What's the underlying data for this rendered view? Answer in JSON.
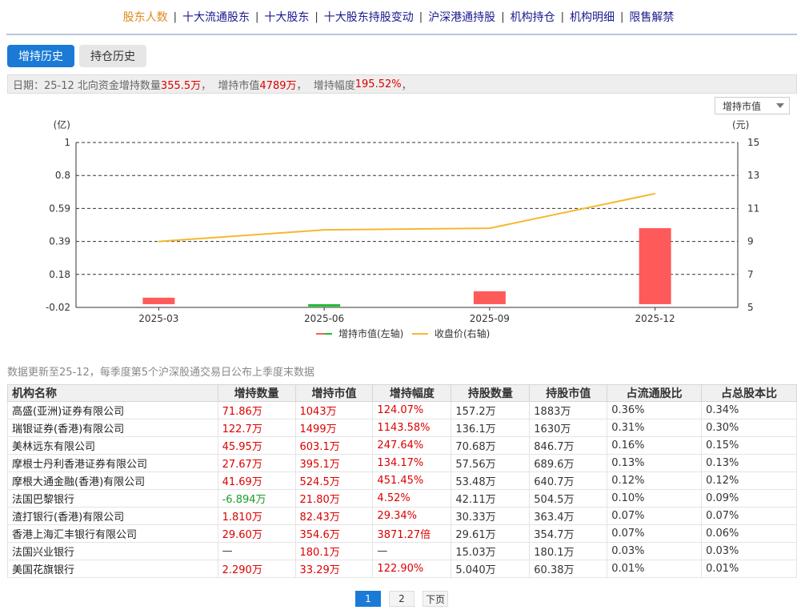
{
  "nav": {
    "items": [
      "股东人数",
      "十大流通股东",
      "十大股东",
      "十大股东持股变动",
      "沪深港通持股",
      "机构持仓",
      "机构明细",
      "限售解禁"
    ],
    "separator": "|",
    "active_index": 0,
    "active_color": "#e08a1e"
  },
  "tabs": {
    "increase": "增持历史",
    "hold": "持仓历史"
  },
  "info": {
    "prefix": "日期：25-12 北向资金增持数量",
    "qty": "355.5万",
    "mid1": "，  增持市值",
    "value": "4789万",
    "mid2": "，  增持幅度",
    "pct": "195.52%",
    "suffix": "，"
  },
  "select": {
    "value": "增持市值"
  },
  "chart_data": {
    "type": "bar",
    "categories": [
      "2025-03",
      "2025-06",
      "2025-09",
      "2025-12"
    ],
    "left_unit": "(亿)",
    "right_unit": "(元)",
    "left_ticks": [
      "1",
      "0.8",
      "0.59",
      "0.39",
      "0.18",
      "-0.02"
    ],
    "right_ticks": [
      "15",
      "13",
      "11",
      "9",
      "7",
      "5"
    ],
    "left_ylim": [
      -0.02,
      1
    ],
    "right_ylim": [
      5,
      15
    ],
    "series": [
      {
        "name": "增持市值(左轴)",
        "type": "bar",
        "axis": "left",
        "values": [
          0.04,
          -0.01,
          0.08,
          0.47
        ],
        "colors": [
          "#ff5a5a",
          "#22bb33",
          "#ff5a5a",
          "#ff5a5a"
        ]
      },
      {
        "name": "收盘价(右轴)",
        "type": "line",
        "axis": "right",
        "values": [
          9.0,
          9.7,
          9.8,
          11.9
        ],
        "color": "#f5b82e"
      }
    ],
    "legend": [
      "增持市值(左轴)",
      "收盘价(右轴)"
    ],
    "legend_position": "bottom",
    "grid": true
  },
  "note": "数据更新至25-12，每季度第5个沪深股通交易日公布上季度末数据",
  "table": {
    "headers": [
      "机构名称",
      "增持数量",
      "增持市值",
      "增持幅度",
      "持股数量",
      "持股市值",
      "占流通股比",
      "占总股本比"
    ],
    "rows": [
      [
        "高盛(亚洲)证券有限公司",
        "71.86万",
        "1043万",
        "124.07%",
        "157.2万",
        "1883万",
        "0.36%",
        "0.34%"
      ],
      [
        "瑞银证券(香港)有限公司",
        "122.7万",
        "1499万",
        "1143.58%",
        "136.1万",
        "1630万",
        "0.31%",
        "0.30%"
      ],
      [
        "美林远东有限公司",
        "45.95万",
        "603.1万",
        "247.64%",
        "70.68万",
        "846.7万",
        "0.16%",
        "0.15%"
      ],
      [
        "摩根士丹利香港证券有限公司",
        "27.67万",
        "395.1万",
        "134.17%",
        "57.56万",
        "689.6万",
        "0.13%",
        "0.13%"
      ],
      [
        "摩根大通金融(香港)有限公司",
        "41.69万",
        "524.5万",
        "451.45%",
        "53.48万",
        "640.7万",
        "0.12%",
        "0.12%"
      ],
      [
        "法国巴黎银行",
        "-6.894万",
        "21.80万",
        "4.52%",
        "42.11万",
        "504.5万",
        "0.10%",
        "0.09%"
      ],
      [
        "渣打银行(香港)有限公司",
        "1.810万",
        "82.43万",
        "29.34%",
        "30.33万",
        "363.4万",
        "0.07%",
        "0.07%"
      ],
      [
        "香港上海汇丰银行有限公司",
        "29.60万",
        "354.6万",
        "3871.27倍",
        "29.61万",
        "354.7万",
        "0.07%",
        "0.06%"
      ],
      [
        "法国兴业银行",
        "—",
        "180.1万",
        "—",
        "15.03万",
        "180.1万",
        "0.03%",
        "0.03%"
      ],
      [
        "美国花旗银行",
        "2.290万",
        "33.29万",
        "122.90%",
        "5.040万",
        "60.38万",
        "0.01%",
        "0.01%"
      ]
    ]
  },
  "pager": {
    "pages": [
      "1",
      "2"
    ],
    "current": "1",
    "next": "下页"
  }
}
